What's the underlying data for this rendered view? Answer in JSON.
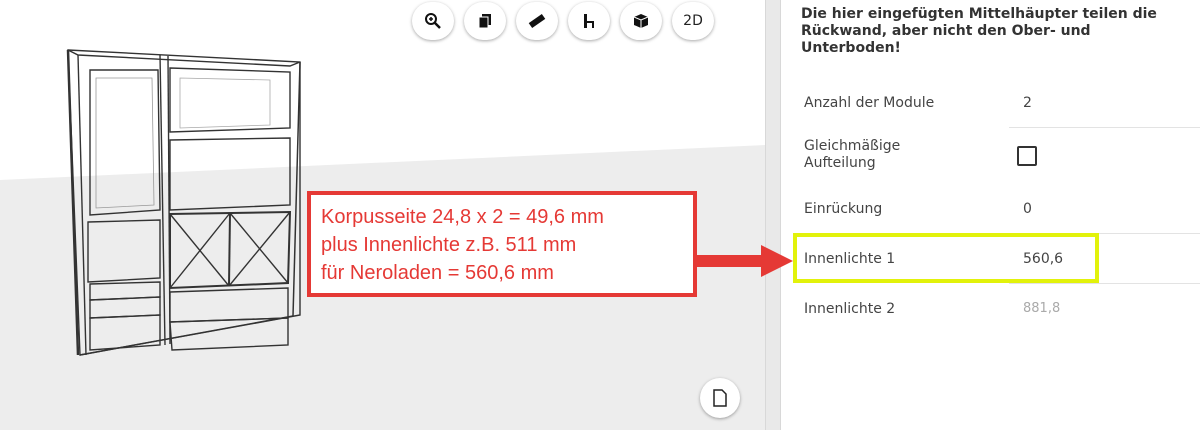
{
  "toolbar": {
    "buttons": [
      {
        "icon": "zoom-icon"
      },
      {
        "icon": "copy-icon"
      },
      {
        "icon": "measure-icon"
      },
      {
        "icon": "chair-icon"
      },
      {
        "icon": "cube-icon"
      },
      {
        "label": "2D"
      }
    ]
  },
  "panel": {
    "notice": "Die hier eingefügten Mittelhäupter teilen die Rückwand, aber nicht den Ober- und Unterboden!",
    "fields": {
      "modules": {
        "label": "Anzahl der Module",
        "value": "2"
      },
      "even_split": {
        "label_line1": "Gleichmäßige",
        "label_line2": "Aufteilung",
        "checked": false
      },
      "indent": {
        "label": "Einrückung",
        "value": "0"
      },
      "inner1": {
        "label": "Innenlichte 1",
        "value": "560,6"
      },
      "inner2": {
        "label": "Innenlichte 2",
        "value": "881,8"
      }
    }
  },
  "annotation": {
    "line1": "Korpusseite 24,8 x 2 = 49,6 mm",
    "line2": "plus Innenlichte z.B. 511 mm",
    "line3": "für Neroladen = 560,6 mm",
    "color": "#e53935",
    "highlight_color": "#e2f20b"
  },
  "colors": {
    "panel_text": "#444444",
    "floor": "#ededed"
  }
}
